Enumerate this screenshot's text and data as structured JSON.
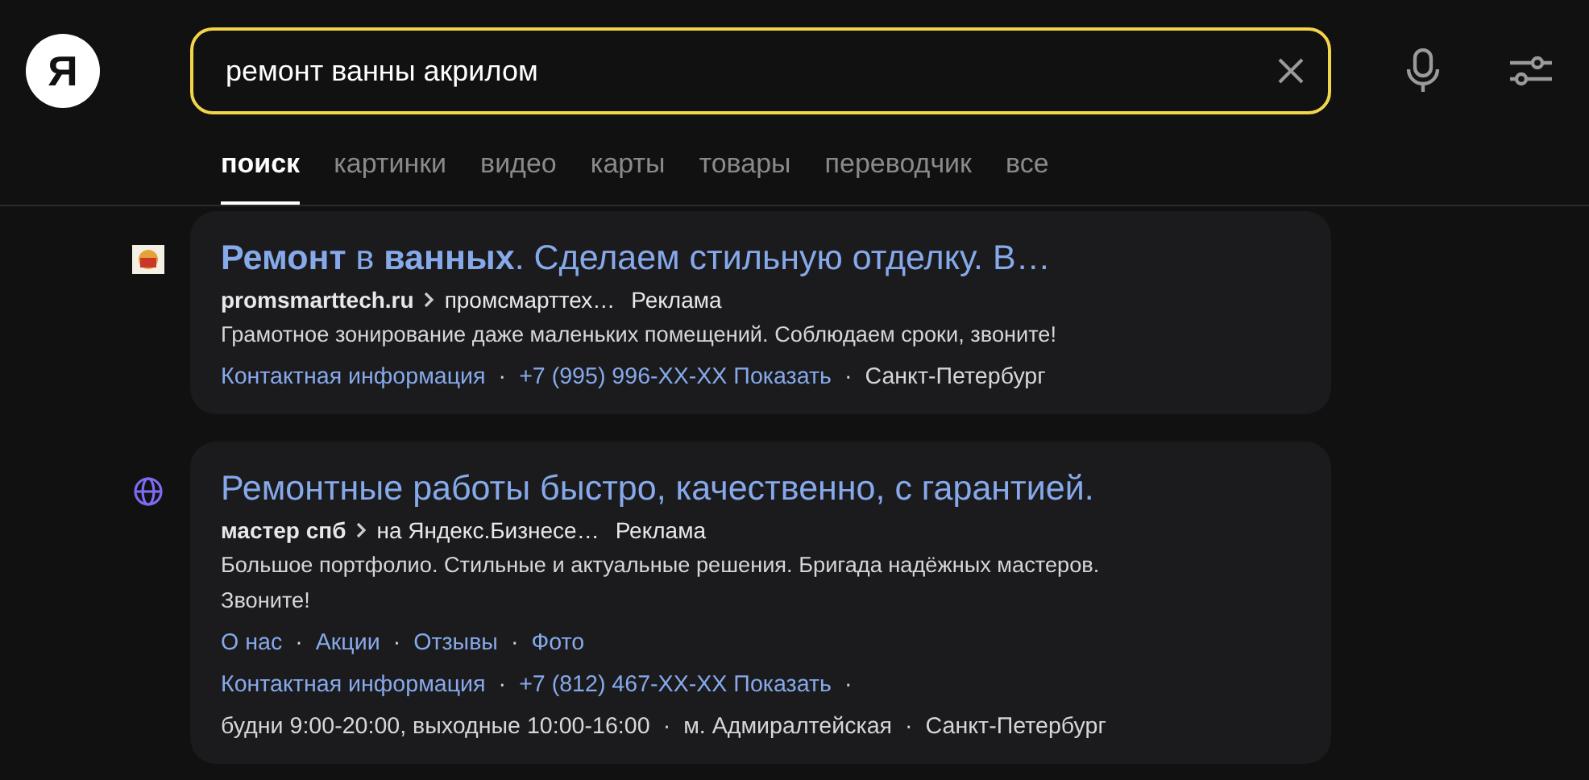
{
  "logo": {
    "text": "Я"
  },
  "search": {
    "value": "ремонт ванны акрилом"
  },
  "tabs": [
    {
      "label": "поиск",
      "selected": true
    },
    {
      "label": "картинки",
      "selected": false
    },
    {
      "label": "видео",
      "selected": false
    },
    {
      "label": "карты",
      "selected": false
    },
    {
      "label": "товары",
      "selected": false
    },
    {
      "label": "переводчик",
      "selected": false
    },
    {
      "label": "все",
      "selected": false
    }
  ],
  "results": [
    {
      "favicon": {
        "kind": "image"
      },
      "title": "**Ремонт** в **ванных**. Сделаем стильную отделку. В…",
      "site": "promsmarttech.ru",
      "path": "промсмарттех…",
      "label": "Реклама",
      "description": "Грамотное зонирование даже маленьких помещений. Соблюдаем сроки, звоните!",
      "lines": [
        [
          {
            "kind": "link",
            "text": "Контактная информация"
          },
          {
            "kind": "sep",
            "text": "·"
          },
          {
            "kind": "link",
            "text": "+7 (995) 996-XX-XX Показать"
          },
          {
            "kind": "sep",
            "text": "·"
          },
          {
            "kind": "plain",
            "text": "Санкт-Петербург"
          }
        ]
      ]
    },
    {
      "favicon": {
        "kind": "globe"
      },
      "title": "Ремонтные работы быстро, качественно, с гарантией.",
      "site": "мастер спб",
      "path": "на Яндекс.Бизнесе…",
      "label": "Реклама",
      "description": "Большое портфолио. Стильные и актуальные решения. Бригада надёжных мастеров. Звоните!",
      "lines": [
        [
          {
            "kind": "link",
            "text": "О нас"
          },
          {
            "kind": "sep",
            "text": "·"
          },
          {
            "kind": "link",
            "text": "Акции"
          },
          {
            "kind": "sep",
            "text": "·"
          },
          {
            "kind": "link",
            "text": "Отзывы"
          },
          {
            "kind": "sep",
            "text": "·"
          },
          {
            "kind": "link",
            "text": "Фото"
          }
        ],
        [
          {
            "kind": "link",
            "text": "Контактная информация"
          },
          {
            "kind": "sep",
            "text": "·"
          },
          {
            "kind": "link",
            "text": "+7 (812) 467-XX-XX Показать"
          },
          {
            "kind": "sep",
            "text": "·"
          }
        ],
        [
          {
            "kind": "plain",
            "text": "будни 9:00-20:00, выходные 10:00-16:00"
          },
          {
            "kind": "sep",
            "text": "·"
          },
          {
            "kind": "plain",
            "text": "м. Адмиралтейская"
          },
          {
            "kind": "sep",
            "text": "·"
          },
          {
            "kind": "plain",
            "text": "Санкт-Петербург"
          }
        ]
      ]
    }
  ]
}
